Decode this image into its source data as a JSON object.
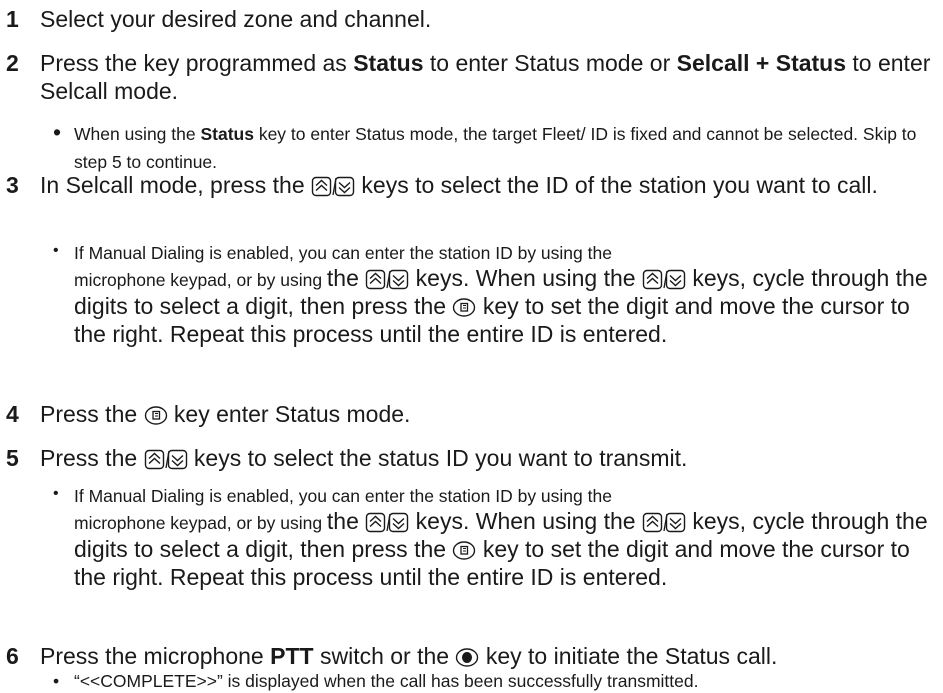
{
  "steps": [
    {
      "number": "1",
      "text": "Select your desired zone and channel."
    },
    {
      "number": "2",
      "t1": "Press the key programmed as ",
      "t2": "Status",
      "t3": " to enter Status mode or ",
      "t4": "Selcall + Status",
      "t5": " to enter Selcall mode.",
      "bullet": {
        "t1": "When using the ",
        "t2": "Status",
        "t3": " key to enter Status mode, the target Fleet/ ID is fixed and cannot be selected.  Skip to step 5 to continue."
      }
    },
    {
      "number": "3",
      "t1": "In Selcall mode, press the ",
      "t2": " keys to select the ID of the station you want to call.",
      "bullet": {
        "small1": "If Manual Dialing is enabled, you can enter the station ID by using the",
        "small2": "microphone keypad, or by using ",
        "b1": "the ",
        "b2": " keys.  When using the ",
        "b3": " keys, cycle through the digits to select a digit, then press the ",
        "b4": " key to set the digit and move the cursor to the right.  Repeat this process until the entire ID is entered."
      }
    },
    {
      "number": "4",
      "t1": "Press the ",
      "t2": " key enter Status mode."
    },
    {
      "number": "5",
      "t1": "Press the ",
      "t2": " keys to select the status ID you want to transmit.",
      "bullet": {
        "small1": "If Manual Dialing is enabled, you can enter the station ID by using the",
        "small2": "microphone keypad, or by using ",
        "b1": "the ",
        "b2": " keys.  When using the ",
        "b3": " keys, cycle through the digits to select a digit, then press the ",
        "b4": " key to set the digit and move the cursor to the right.  Repeat this process until the entire ID is entered."
      }
    },
    {
      "number": "6",
      "t1": "Press the microphone ",
      "t2": "PTT",
      "t3": " switch or the ",
      "t4": " key to initiate the Status call.",
      "bullet": {
        "text": "“<<COMPLETE>>” is displayed when the call has been successfully transmitted."
      }
    }
  ],
  "icons": {
    "up_down": "up-down-arrow-keys-icon",
    "function": "function-key-icon",
    "transmit": "transmit-key-icon"
  }
}
